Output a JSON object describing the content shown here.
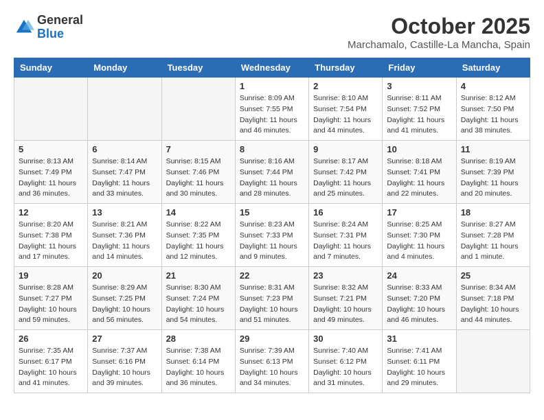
{
  "header": {
    "logo_general": "General",
    "logo_blue": "Blue",
    "month_title": "October 2025",
    "location": "Marchamalo, Castille-La Mancha, Spain"
  },
  "weekdays": [
    "Sunday",
    "Monday",
    "Tuesday",
    "Wednesday",
    "Thursday",
    "Friday",
    "Saturday"
  ],
  "weeks": [
    [
      {
        "day": "",
        "info": ""
      },
      {
        "day": "",
        "info": ""
      },
      {
        "day": "",
        "info": ""
      },
      {
        "day": "1",
        "info": "Sunrise: 8:09 AM\nSunset: 7:55 PM\nDaylight: 11 hours\nand 46 minutes."
      },
      {
        "day": "2",
        "info": "Sunrise: 8:10 AM\nSunset: 7:54 PM\nDaylight: 11 hours\nand 44 minutes."
      },
      {
        "day": "3",
        "info": "Sunrise: 8:11 AM\nSunset: 7:52 PM\nDaylight: 11 hours\nand 41 minutes."
      },
      {
        "day": "4",
        "info": "Sunrise: 8:12 AM\nSunset: 7:50 PM\nDaylight: 11 hours\nand 38 minutes."
      }
    ],
    [
      {
        "day": "5",
        "info": "Sunrise: 8:13 AM\nSunset: 7:49 PM\nDaylight: 11 hours\nand 36 minutes."
      },
      {
        "day": "6",
        "info": "Sunrise: 8:14 AM\nSunset: 7:47 PM\nDaylight: 11 hours\nand 33 minutes."
      },
      {
        "day": "7",
        "info": "Sunrise: 8:15 AM\nSunset: 7:46 PM\nDaylight: 11 hours\nand 30 minutes."
      },
      {
        "day": "8",
        "info": "Sunrise: 8:16 AM\nSunset: 7:44 PM\nDaylight: 11 hours\nand 28 minutes."
      },
      {
        "day": "9",
        "info": "Sunrise: 8:17 AM\nSunset: 7:42 PM\nDaylight: 11 hours\nand 25 minutes."
      },
      {
        "day": "10",
        "info": "Sunrise: 8:18 AM\nSunset: 7:41 PM\nDaylight: 11 hours\nand 22 minutes."
      },
      {
        "day": "11",
        "info": "Sunrise: 8:19 AM\nSunset: 7:39 PM\nDaylight: 11 hours\nand 20 minutes."
      }
    ],
    [
      {
        "day": "12",
        "info": "Sunrise: 8:20 AM\nSunset: 7:38 PM\nDaylight: 11 hours\nand 17 minutes."
      },
      {
        "day": "13",
        "info": "Sunrise: 8:21 AM\nSunset: 7:36 PM\nDaylight: 11 hours\nand 14 minutes."
      },
      {
        "day": "14",
        "info": "Sunrise: 8:22 AM\nSunset: 7:35 PM\nDaylight: 11 hours\nand 12 minutes."
      },
      {
        "day": "15",
        "info": "Sunrise: 8:23 AM\nSunset: 7:33 PM\nDaylight: 11 hours\nand 9 minutes."
      },
      {
        "day": "16",
        "info": "Sunrise: 8:24 AM\nSunset: 7:31 PM\nDaylight: 11 hours\nand 7 minutes."
      },
      {
        "day": "17",
        "info": "Sunrise: 8:25 AM\nSunset: 7:30 PM\nDaylight: 11 hours\nand 4 minutes."
      },
      {
        "day": "18",
        "info": "Sunrise: 8:27 AM\nSunset: 7:28 PM\nDaylight: 11 hours\nand 1 minute."
      }
    ],
    [
      {
        "day": "19",
        "info": "Sunrise: 8:28 AM\nSunset: 7:27 PM\nDaylight: 10 hours\nand 59 minutes."
      },
      {
        "day": "20",
        "info": "Sunrise: 8:29 AM\nSunset: 7:25 PM\nDaylight: 10 hours\nand 56 minutes."
      },
      {
        "day": "21",
        "info": "Sunrise: 8:30 AM\nSunset: 7:24 PM\nDaylight: 10 hours\nand 54 minutes."
      },
      {
        "day": "22",
        "info": "Sunrise: 8:31 AM\nSunset: 7:23 PM\nDaylight: 10 hours\nand 51 minutes."
      },
      {
        "day": "23",
        "info": "Sunrise: 8:32 AM\nSunset: 7:21 PM\nDaylight: 10 hours\nand 49 minutes."
      },
      {
        "day": "24",
        "info": "Sunrise: 8:33 AM\nSunset: 7:20 PM\nDaylight: 10 hours\nand 46 minutes."
      },
      {
        "day": "25",
        "info": "Sunrise: 8:34 AM\nSunset: 7:18 PM\nDaylight: 10 hours\nand 44 minutes."
      }
    ],
    [
      {
        "day": "26",
        "info": "Sunrise: 7:35 AM\nSunset: 6:17 PM\nDaylight: 10 hours\nand 41 minutes."
      },
      {
        "day": "27",
        "info": "Sunrise: 7:37 AM\nSunset: 6:16 PM\nDaylight: 10 hours\nand 39 minutes."
      },
      {
        "day": "28",
        "info": "Sunrise: 7:38 AM\nSunset: 6:14 PM\nDaylight: 10 hours\nand 36 minutes."
      },
      {
        "day": "29",
        "info": "Sunrise: 7:39 AM\nSunset: 6:13 PM\nDaylight: 10 hours\nand 34 minutes."
      },
      {
        "day": "30",
        "info": "Sunrise: 7:40 AM\nSunset: 6:12 PM\nDaylight: 10 hours\nand 31 minutes."
      },
      {
        "day": "31",
        "info": "Sunrise: 7:41 AM\nSunset: 6:11 PM\nDaylight: 10 hours\nand 29 minutes."
      },
      {
        "day": "",
        "info": ""
      }
    ]
  ]
}
